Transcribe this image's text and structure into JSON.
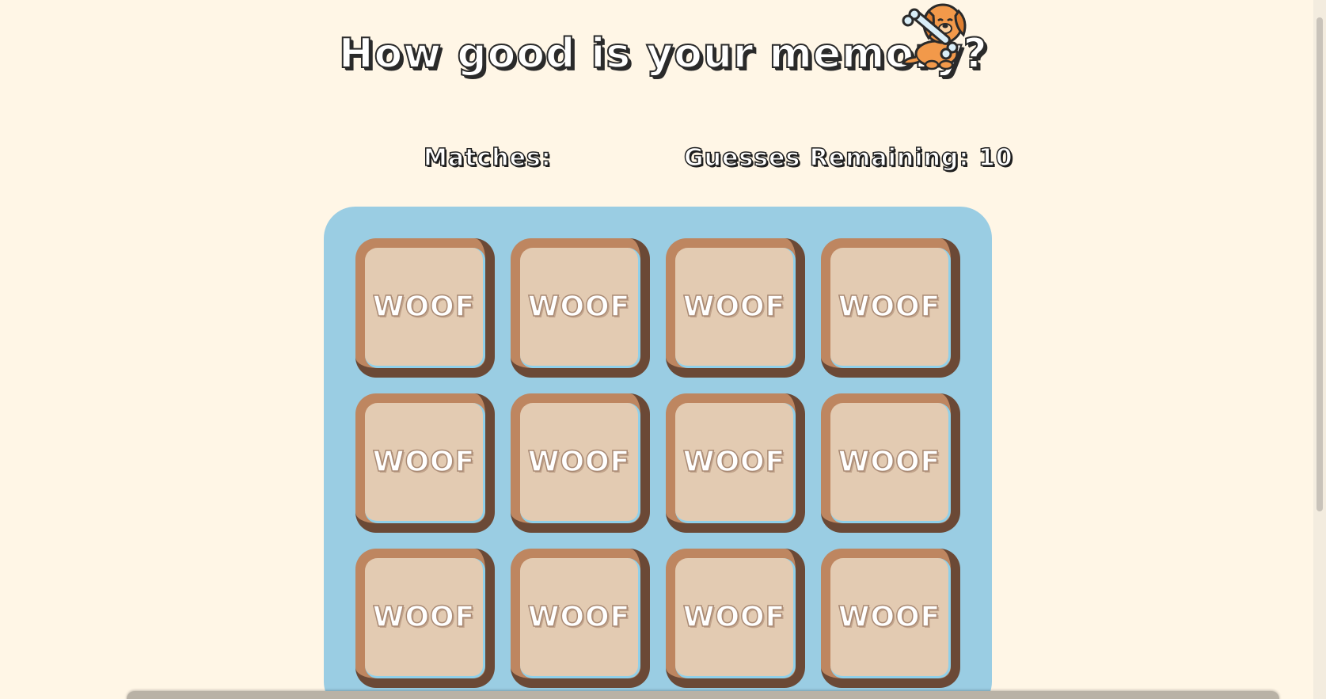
{
  "header": {
    "title": "How good is your memory?",
    "logo_icon": "dog-with-bone-icon"
  },
  "stats": {
    "matches_label": "Matches:",
    "guesses_label": "Guesses Remaining: 10"
  },
  "board": {
    "cards": [
      {
        "label": "WOOF"
      },
      {
        "label": "WOOF"
      },
      {
        "label": "WOOF"
      },
      {
        "label": "WOOF"
      },
      {
        "label": "WOOF"
      },
      {
        "label": "WOOF"
      },
      {
        "label": "WOOF"
      },
      {
        "label": "WOOF"
      },
      {
        "label": "WOOF"
      },
      {
        "label": "WOOF"
      },
      {
        "label": "WOOF"
      },
      {
        "label": "WOOF"
      }
    ]
  },
  "colors": {
    "background": "#fff6e6",
    "board": "#9acde3",
    "card_frame": "#be8660",
    "card_shadow": "#6b4936",
    "card_face": "#e3cbb2"
  }
}
